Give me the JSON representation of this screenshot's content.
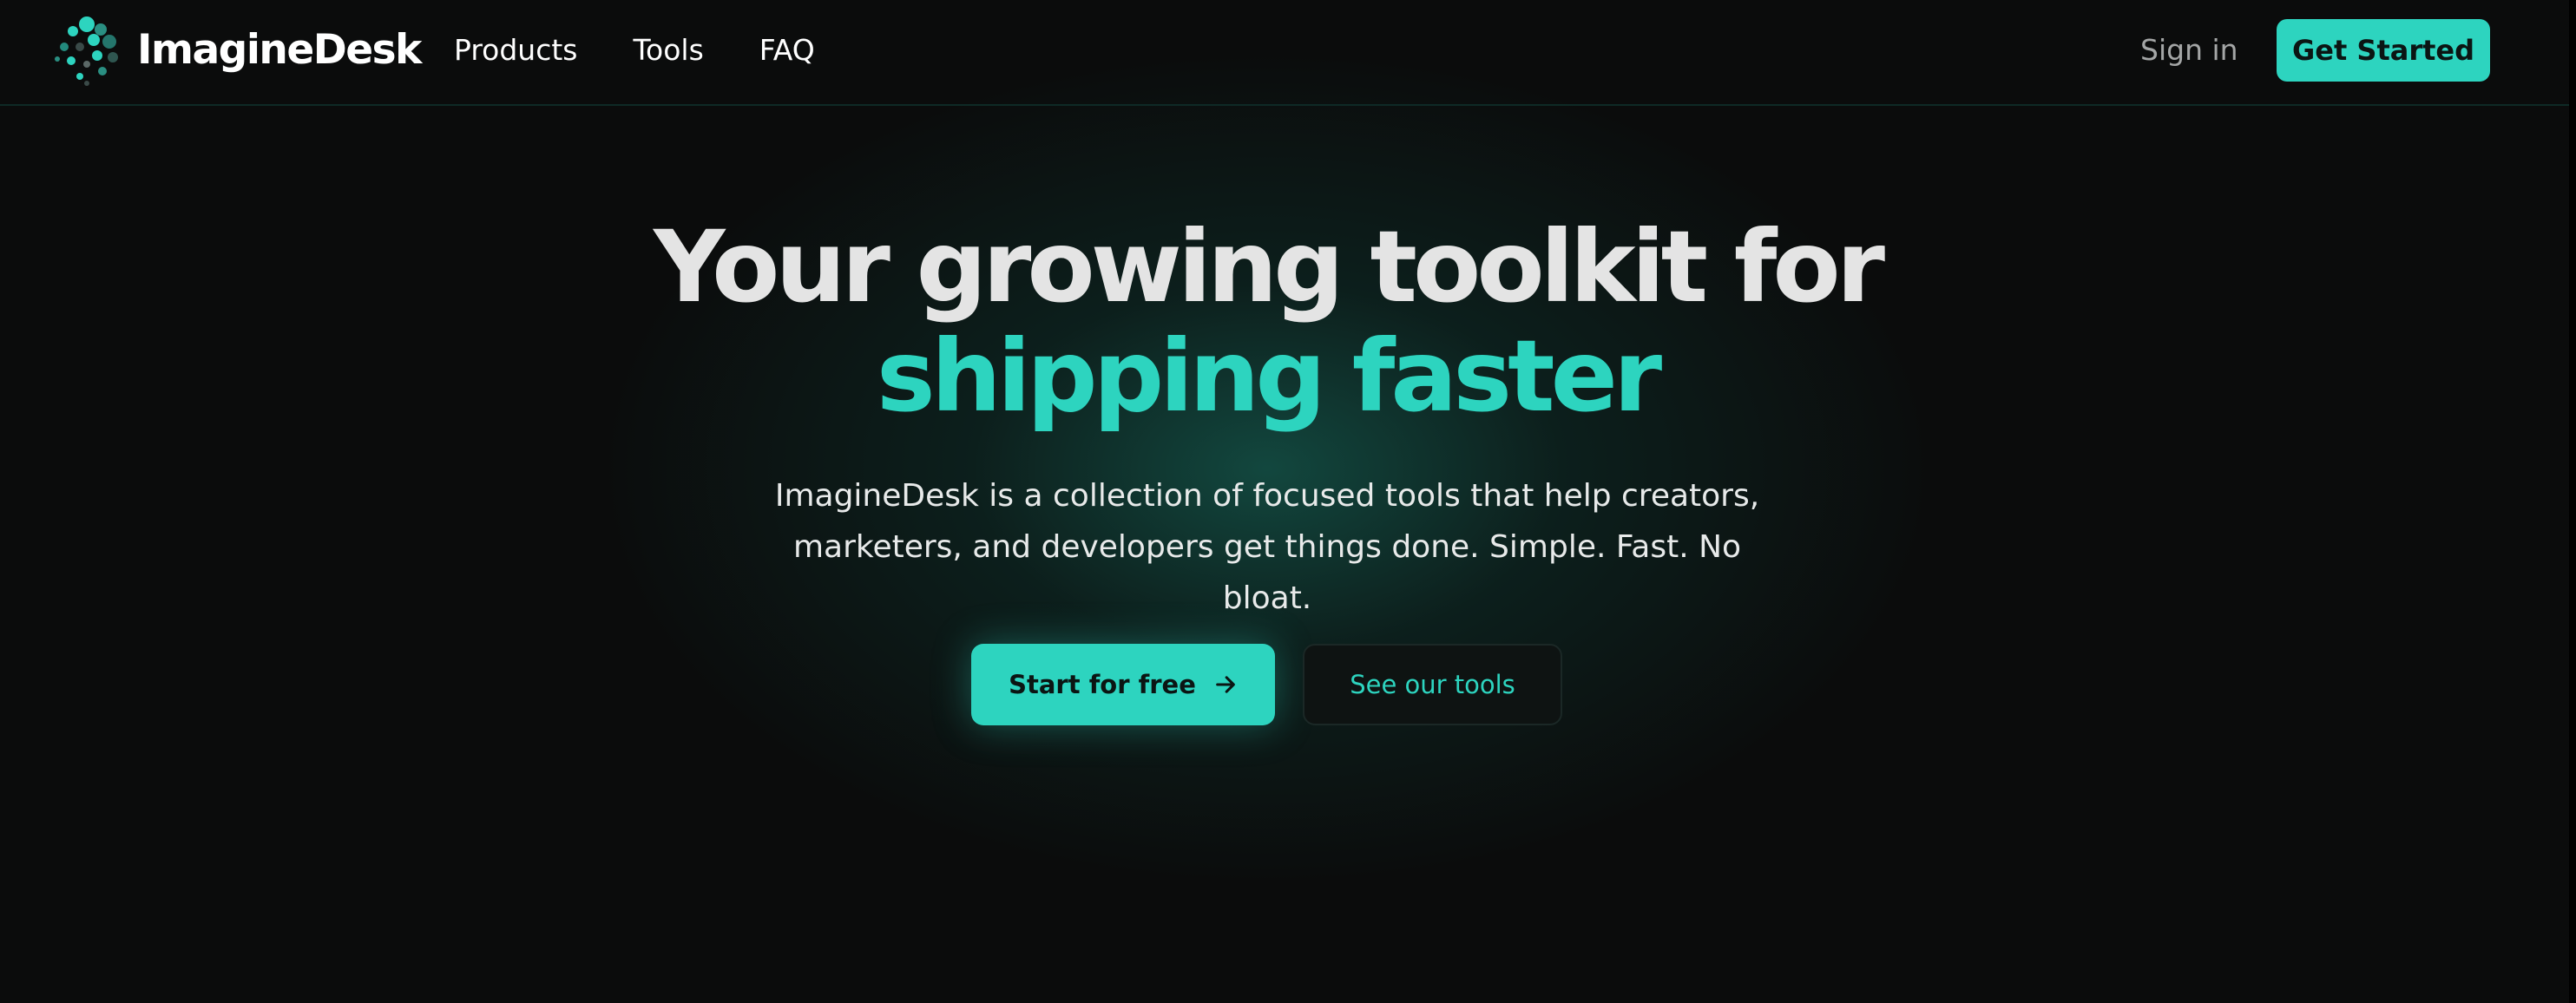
{
  "brand": {
    "name": "ImagineDesk",
    "logo_icon": "dotted-circle-logo-icon",
    "accent_color": "#2dd4bf",
    "background_color": "#0b0c0c"
  },
  "nav": {
    "links": [
      {
        "label": "Products"
      },
      {
        "label": "Tools"
      },
      {
        "label": "FAQ"
      }
    ],
    "sign_in_label": "Sign in",
    "get_started_label": "Get Started"
  },
  "hero": {
    "headline_line1": "Your growing toolkit for",
    "headline_line2": "shipping faster",
    "subtitle_line1": "ImagineDesk is a collection of focused tools that help creators,",
    "subtitle_line2": "marketers, and developers get things done. Simple. Fast. No bloat.",
    "primary_cta_label": "Start for free",
    "primary_cta_icon": "arrow-right-icon",
    "secondary_cta_label": "See our tools"
  }
}
